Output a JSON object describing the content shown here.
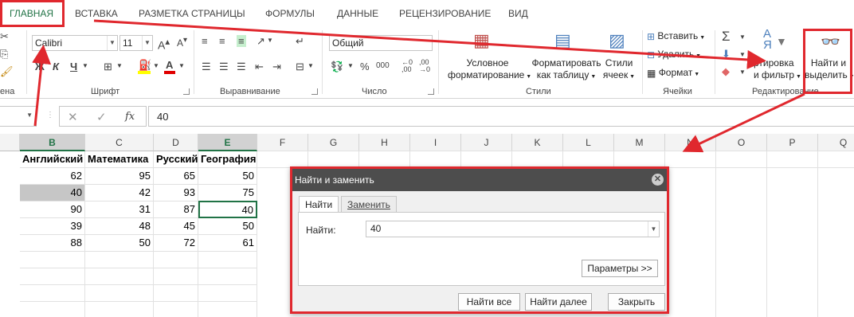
{
  "ribbon_tabs": [
    "ГЛАВНАЯ",
    "ВСТАВКА",
    "РАЗМЕТКА СТРАНИЦЫ",
    "ФОРМУЛЫ",
    "ДАННЫЕ",
    "РЕЦЕНЗИРОВАНИЕ",
    "ВИД"
  ],
  "font": {
    "name": "Calibri",
    "size": "11",
    "bold": "Ж",
    "italic": "К",
    "underline": "Ч",
    "group_label": "Шрифт"
  },
  "clipboard": {
    "group_label_partial": "ена"
  },
  "alignment": {
    "group_label": "Выравнивание"
  },
  "number": {
    "format": "Общий",
    "group_label": "Число"
  },
  "styles": {
    "conditional": [
      "Условное",
      "форматирование"
    ],
    "as_table": [
      "Форматировать",
      "как таблицу"
    ],
    "cell_styles": [
      "Стили",
      "ячеек"
    ],
    "group_label": "Стили"
  },
  "cells": {
    "insert": "Вставить",
    "delete": "Удалить",
    "format": "Формат",
    "group_label": "Ячейки"
  },
  "editing": {
    "sort": [
      "ртировка",
      "и фильтр"
    ],
    "find": [
      "Найти и",
      "выделить"
    ],
    "group_label": "Редактирование"
  },
  "formula_bar": {
    "cancel": "✕",
    "enter": "✓",
    "fx": "fx",
    "value": "40"
  },
  "columns": [
    "B",
    "C",
    "D",
    "E",
    "F",
    "G",
    "H",
    "I",
    "J",
    "K",
    "L",
    "M",
    "N",
    "O",
    "P",
    "Q"
  ],
  "table": {
    "headers": [
      "Английский",
      "Математика",
      "Русский",
      "География"
    ],
    "rows": [
      [
        "62",
        "95",
        "65",
        "50"
      ],
      [
        "40",
        "42",
        "93",
        "75"
      ],
      [
        "90",
        "31",
        "87",
        "40"
      ],
      [
        "39",
        "48",
        "45",
        "50"
      ],
      [
        "88",
        "50",
        "72",
        "61"
      ]
    ]
  },
  "dialog": {
    "title": "Найти и заменить",
    "close": "✕",
    "tab_find": "Найти",
    "tab_replace": "Заменить",
    "find_label": "Найти:",
    "find_value": "40",
    "options_button": "Параметры >>",
    "find_all_button": "Найти все",
    "find_next_button": "Найти далее",
    "close_button": "Закрыть"
  },
  "colors": {
    "annotation_red": "#e0282e",
    "excel_green": "#217346",
    "dialog_title_bg": "#4d4d4d"
  }
}
